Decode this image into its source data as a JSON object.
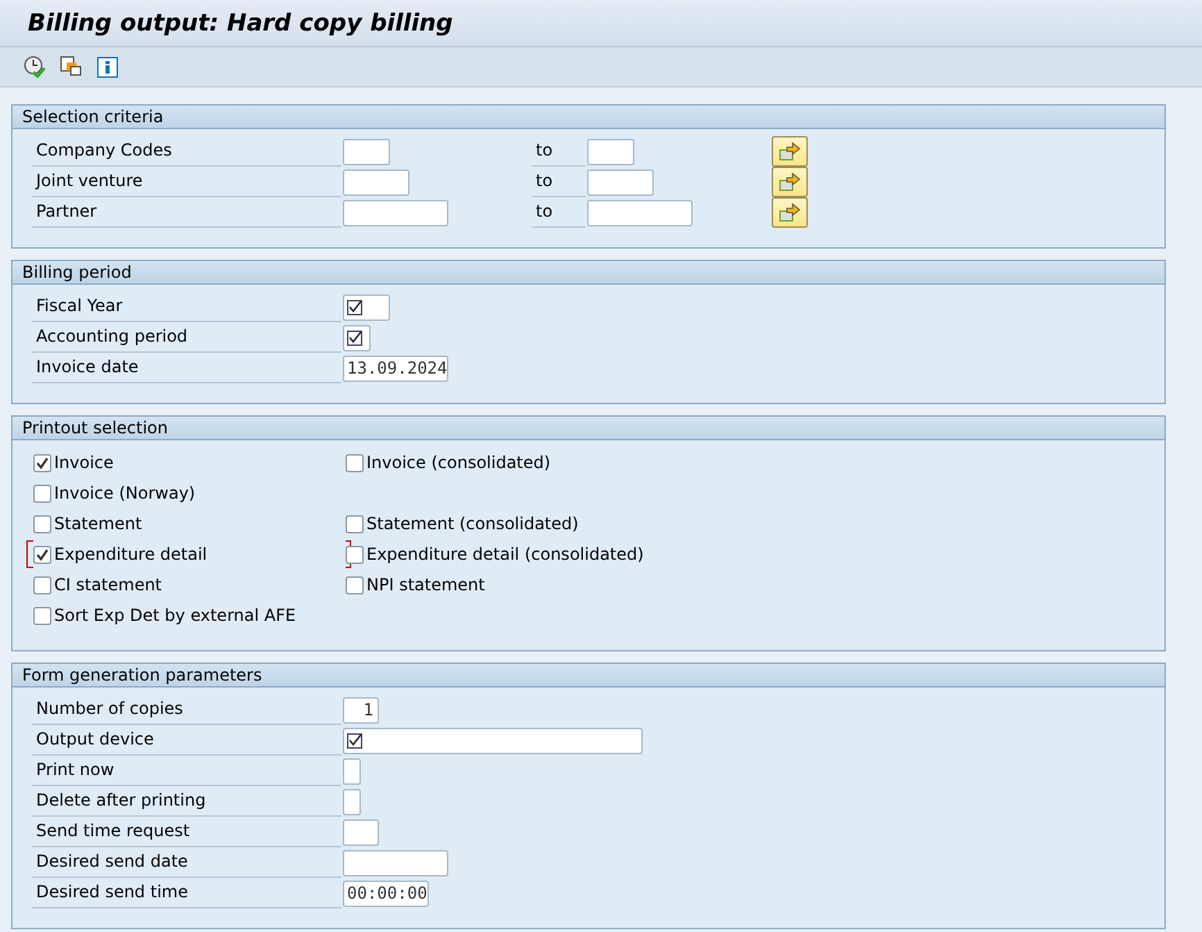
{
  "window": {
    "title": "Billing output: Hard copy billing"
  },
  "toolbar": [
    {
      "kind": "execute"
    },
    {
      "kind": "variants"
    },
    {
      "kind": "info"
    }
  ],
  "selection_criteria": {
    "title": "Selection criteria",
    "rows": [
      {
        "label": "Company Codes",
        "to_label": "to"
      },
      {
        "label": "Joint venture",
        "to_label": "to"
      },
      {
        "label": "Partner",
        "to_label": "to"
      }
    ]
  },
  "billing_period": {
    "title": "Billing period",
    "fields": [
      {
        "label": "Fiscal Year",
        "required": true
      },
      {
        "label": "Accounting period",
        "required": true
      },
      {
        "label": "Invoice date",
        "value": "13.09.2024"
      }
    ]
  },
  "printout_selection": {
    "title": "Printout selection",
    "rows": [
      [
        {
          "label": "Invoice",
          "checked": true,
          "focused": false
        },
        {
          "label": "Invoice (consolidated)",
          "checked": false,
          "focused": false
        }
      ],
      [
        {
          "label": "Invoice (Norway)",
          "checked": false,
          "focused": false
        }
      ],
      [
        {
          "label": "Statement",
          "checked": false,
          "focused": false
        },
        {
          "label": "Statement (consolidated)",
          "checked": false,
          "focused": false
        }
      ],
      [
        {
          "label": "Expenditure detail",
          "checked": true,
          "focused": true
        },
        {
          "label": "Expenditure detail (consolidated)",
          "checked": false,
          "focused": false
        }
      ],
      [
        {
          "label": "CI statement",
          "checked": false,
          "focused": false
        },
        {
          "label": "NPI statement",
          "checked": false,
          "focused": false
        }
      ],
      [
        {
          "label": "Sort Exp Det by external AFE",
          "checked": false,
          "focused": false
        }
      ]
    ]
  },
  "form_generation_parameters": {
    "title": "Form generation parameters",
    "fields": [
      {
        "label": "Number of copies",
        "required": false,
        "value": "1"
      },
      {
        "label": "Output device",
        "required": true
      },
      {
        "label": "Print now",
        "required": false
      },
      {
        "label": "Delete after printing",
        "required": false
      },
      {
        "label": "Send time request",
        "required": false
      },
      {
        "label": "Desired send date",
        "required": false
      },
      {
        "label": "Desired send time",
        "value": "00:00:00"
      }
    ]
  }
}
